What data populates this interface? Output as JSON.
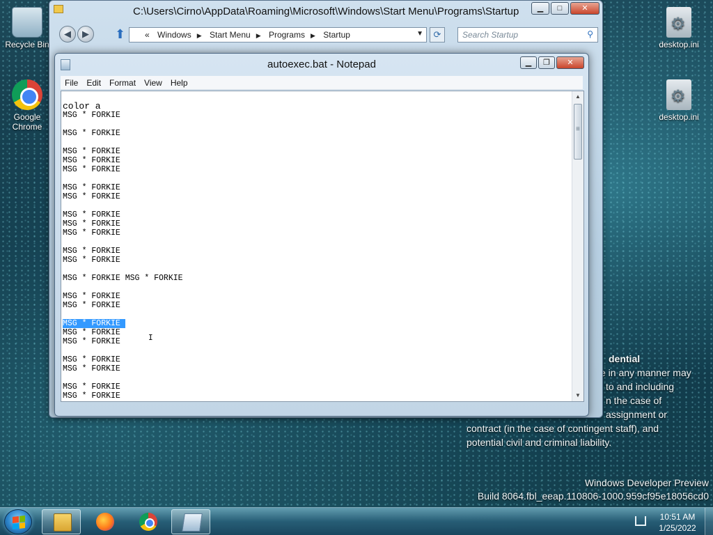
{
  "desktop": {
    "icons": [
      {
        "label": "Recycle Bin"
      },
      {
        "label": "Google Chrome"
      },
      {
        "label": "desktop.ini"
      },
      {
        "label": "desktop.ini"
      }
    ],
    "confidential": {
      "heading": "dential",
      "lines": [
        "e in any manner may",
        "to and including",
        "n the case of",
        "assignment or",
        "contract (in the case of contingent staff), and",
        "potential civil and criminal liability."
      ]
    },
    "watermark": {
      "line1": "Windows Developer Preview",
      "line2": "Build 8064.fbl_eeap.110806-1000.959cf95e18056cd0"
    }
  },
  "explorer": {
    "title": "C:\\Users\\Cirno\\AppData\\Roaming\\Microsoft\\Windows\\Start Menu\\Programs\\Startup",
    "address_prefix": "«",
    "breadcrumbs": [
      "Windows",
      "Start Menu",
      "Programs",
      "Startup"
    ],
    "search_placeholder": "Search Startup"
  },
  "notepad": {
    "title": "autoexec.bat - Notepad",
    "menu": [
      "File",
      "Edit",
      "Format",
      "View",
      "Help"
    ],
    "lines": [
      "color a",
      "MSG * FORKIE",
      "",
      "MSG * FORKIE",
      "",
      "MSG * FORKIE",
      "MSG * FORKIE",
      "MSG * FORKIE",
      "",
      "MSG * FORKIE",
      "MSG * FORKIE",
      "",
      "MSG * FORKIE",
      "MSG * FORKIE",
      "MSG * FORKIE",
      "",
      "MSG * FORKIE",
      "MSG * FORKIE",
      "",
      "MSG * FORKIE MSG * FORKIE",
      "",
      "MSG * FORKIE",
      "MSG * FORKIE",
      "",
      "MSG * FORKIE",
      "MSG * FORKIE",
      "MSG * FORKIE",
      "",
      "MSG * FORKIE",
      "MSG * FORKIE",
      "",
      "MSG * FORKIE",
      "MSG * FORKIE"
    ],
    "selected_line_index": 24
  },
  "taskbar": {
    "time": "10:51 AM",
    "date": "1/25/2022"
  }
}
